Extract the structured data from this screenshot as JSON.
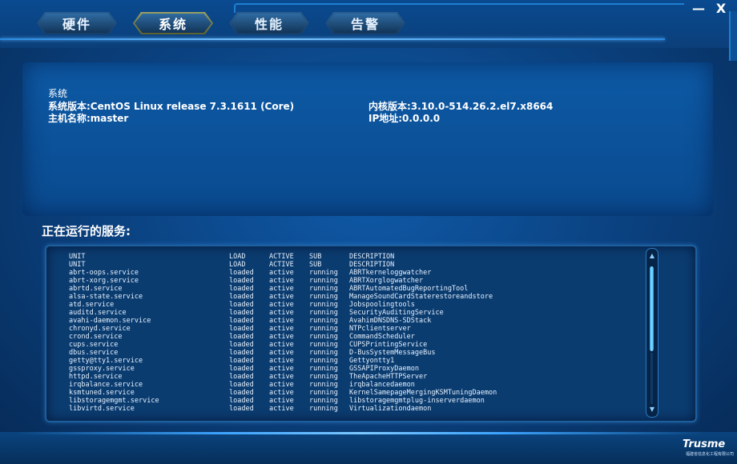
{
  "window": {
    "minimize_label": "—",
    "close_label": "X"
  },
  "tabs": [
    {
      "label": "硬件",
      "active": false
    },
    {
      "label": "系统",
      "active": true
    },
    {
      "label": "性能",
      "active": false
    },
    {
      "label": "告警",
      "active": false
    }
  ],
  "system": {
    "section_title": "系统",
    "os_version": "系统版本:CentOS Linux release 7.3.1611 (Core)",
    "hostname": "主机名称:master",
    "kernel_version": "内核版本:3.10.0-514.26.2.el7.x8664",
    "ip_address": "IP地址:0.0.0.0"
  },
  "services": {
    "title": "正在运行的服务:",
    "header": {
      "unit": "UNIT",
      "load": "LOAD",
      "active": "ACTIVE",
      "sub": "SUB",
      "description": "DESCRIPTION"
    },
    "rows": [
      {
        "unit": "UNIT",
        "load": "LOAD",
        "active": "ACTIVE",
        "sub": "SUB",
        "description": "DESCRIPTION"
      },
      {
        "unit": "abrt-oops.service",
        "load": "loaded",
        "active": "active",
        "sub": "running",
        "description": "ABRTkerneloggwatcher"
      },
      {
        "unit": "abrt-xorg.service",
        "load": "loaded",
        "active": "active",
        "sub": "running",
        "description": "ABRTXorglogwatcher"
      },
      {
        "unit": "abrtd.service",
        "load": "loaded",
        "active": "active",
        "sub": "running",
        "description": "ABRTAutomatedBugReportingTool"
      },
      {
        "unit": "alsa-state.service",
        "load": "loaded",
        "active": "active",
        "sub": "running",
        "description": "ManageSoundCardStaterestoreandstore"
      },
      {
        "unit": "atd.service",
        "load": "loaded",
        "active": "active",
        "sub": "running",
        "description": "Jobspoolingtools"
      },
      {
        "unit": "auditd.service",
        "load": "loaded",
        "active": "active",
        "sub": "running",
        "description": "SecurityAuditingService"
      },
      {
        "unit": "avahi-daemon.service",
        "load": "loaded",
        "active": "active",
        "sub": "running",
        "description": "AvahimDNSDNS-SDStack"
      },
      {
        "unit": "chronyd.service",
        "load": "loaded",
        "active": "active",
        "sub": "running",
        "description": "NTPclientserver"
      },
      {
        "unit": "crond.service",
        "load": "loaded",
        "active": "active",
        "sub": "running",
        "description": "CommandScheduler"
      },
      {
        "unit": "cups.service",
        "load": "loaded",
        "active": "active",
        "sub": "running",
        "description": "CUPSPrintingService"
      },
      {
        "unit": "dbus.service",
        "load": "loaded",
        "active": "active",
        "sub": "running",
        "description": "D-BusSystemMessageBus"
      },
      {
        "unit": "getty@tty1.service",
        "load": "loaded",
        "active": "active",
        "sub": "running",
        "description": "Gettyontty1"
      },
      {
        "unit": "gssproxy.service",
        "load": "loaded",
        "active": "active",
        "sub": "running",
        "description": "GSSAPIProxyDaemon"
      },
      {
        "unit": "httpd.service",
        "load": "loaded",
        "active": "active",
        "sub": "running",
        "description": "TheApacheHTTPServer"
      },
      {
        "unit": "irqbalance.service",
        "load": "loaded",
        "active": "active",
        "sub": "running",
        "description": "irqbalancedaemon"
      },
      {
        "unit": "ksmtuned.service",
        "load": "loaded",
        "active": "active",
        "sub": "running",
        "description": "KernelSamepageMergingKSMTuningDaemon"
      },
      {
        "unit": "libstoragemgmt.service",
        "load": "loaded",
        "active": "active",
        "sub": "running",
        "description": "libstoragemgmtplug-inserverdaemon"
      },
      {
        "unit": "libvirtd.service",
        "load": "loaded",
        "active": "active",
        "sub": "running",
        "description": "Virtualizationdaemon"
      }
    ]
  },
  "brand": {
    "logo_text": "Trusme",
    "logo_sub": "福建省信息化工程有限公司"
  },
  "colors": {
    "background": "#0a3f7c",
    "tab_active": "#9aa062",
    "tab_inactive": "#2a5f92",
    "accent": "#3da4ff"
  }
}
